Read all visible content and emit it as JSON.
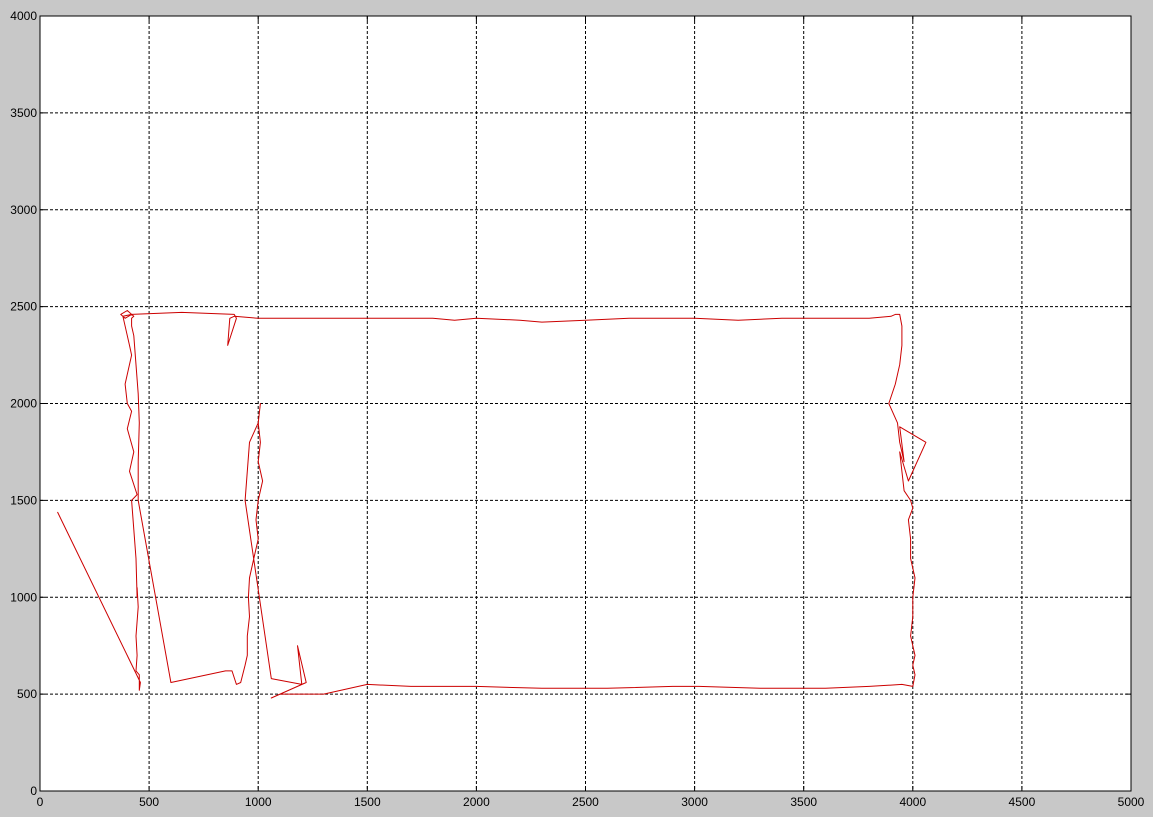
{
  "chart_data": {
    "type": "line",
    "title": "",
    "xlabel": "",
    "ylabel": "",
    "xlim": [
      0,
      5000
    ],
    "ylim": [
      0,
      4000
    ],
    "xticks": [
      0,
      500,
      1000,
      1500,
      2000,
      2500,
      3000,
      3500,
      4000,
      4500,
      5000
    ],
    "yticks": [
      0,
      500,
      1000,
      1500,
      2000,
      2500,
      3000,
      3500,
      4000
    ],
    "xtick_labels": [
      "0",
      "500",
      "1000",
      "1500",
      "2000",
      "2500",
      "3000",
      "3500",
      "4000",
      "4500",
      "5000"
    ],
    "ytick_labels": [
      "0",
      "500",
      "1000",
      "1500",
      "2000",
      "2500",
      "3000",
      "3500",
      "4000"
    ],
    "grid": true,
    "grid_style": "dashed",
    "legend": "none",
    "colors": {
      "line": "#cc0000",
      "figure_bg": "#c8c8c8",
      "axes_bg": "#ffffff",
      "grid": "#000000"
    },
    "series": [
      {
        "x": [
          80,
          460,
          455,
          455,
          440,
          445,
          440,
          450,
          445,
          445,
          440,
          430,
          420,
          445,
          410,
          430,
          400,
          420,
          400,
          390,
          420,
          410,
          400,
          380,
          420,
          390,
          370,
          400,
          420,
          430,
          420,
          420,
          430,
          440,
          450,
          455,
          450,
          450,
          600,
          850,
          880,
          900,
          920,
          940,
          950,
          950,
          960,
          955,
          960,
          980,
          1000,
          990,
          1000,
          1020,
          1000,
          1010,
          1000,
          1010,
          1000,
          960,
          940,
          1060,
          1200,
          1180,
          1220,
          1060,
          1100,
          1300,
          1500,
          1700,
          2000,
          2300,
          2600,
          2900,
          3020,
          3300,
          3600,
          3800,
          3950,
          4000,
          4010,
          4000,
          4010,
          3990,
          4000,
          4000,
          4010,
          3990,
          3990,
          3980,
          4000,
          3990,
          3960,
          3940,
          3980,
          4060,
          3940,
          3960,
          3940,
          3930,
          3890,
          3920,
          3940,
          3950,
          3950,
          3940,
          3920,
          3900,
          3800,
          3720,
          3600,
          3400,
          3200,
          3000,
          2900,
          2700,
          2500,
          2300,
          2200,
          2000,
          1900,
          1800,
          1700,
          1500,
          1200,
          1000,
          890,
          870,
          860,
          900,
          890,
          650,
          420
        ],
        "y": [
          1440,
          560,
          520,
          600,
          620,
          700,
          800,
          950,
          1050,
          1000,
          1200,
          1350,
          1500,
          1530,
          1650,
          1750,
          1870,
          1960,
          2000,
          2100,
          2250,
          2300,
          2350,
          2450,
          2460,
          2440,
          2460,
          2480,
          2460,
          2450,
          2440,
          2400,
          2350,
          2200,
          2050,
          1900,
          1700,
          1500,
          560,
          620,
          620,
          550,
          560,
          650,
          700,
          800,
          900,
          1000,
          1100,
          1200,
          1300,
          1400,
          1500,
          1600,
          1700,
          1800,
          1900,
          2000,
          1900,
          1800,
          1500,
          580,
          550,
          750,
          560,
          480,
          500,
          500,
          550,
          540,
          540,
          530,
          530,
          540,
          540,
          530,
          530,
          540,
          550,
          540,
          600,
          650,
          700,
          800,
          900,
          1000,
          1100,
          1200,
          1300,
          1400,
          1460,
          1500,
          1550,
          1750,
          1600,
          1800,
          1880,
          1700,
          1800,
          1900,
          2000,
          2100,
          2200,
          2300,
          2400,
          2460,
          2460,
          2450,
          2440,
          2440,
          2440,
          2440,
          2430,
          2440,
          2440,
          2440,
          2430,
          2420,
          2430,
          2440,
          2430,
          2440,
          2440,
          2440,
          2440,
          2440,
          2450,
          2440,
          2300,
          2440,
          2460,
          2470,
          2460
        ]
      }
    ]
  }
}
